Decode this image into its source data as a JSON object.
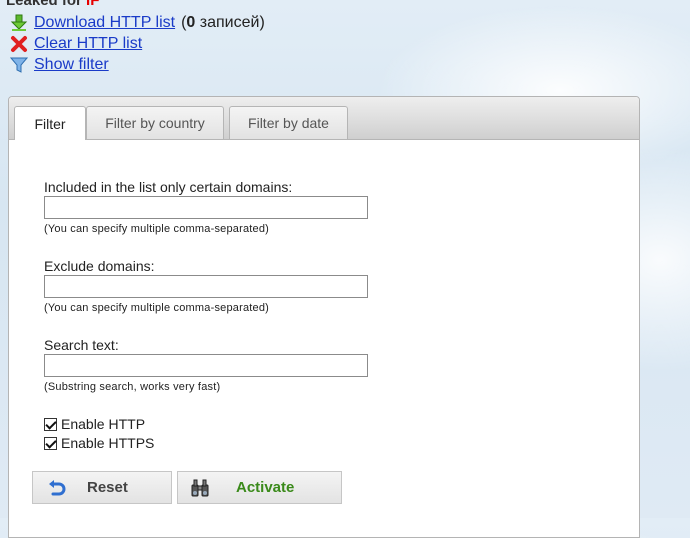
{
  "header": {
    "prefix": "Leaked for",
    "tag": "IF"
  },
  "actions": {
    "download_link": "Download HTTP list",
    "count_open": "(",
    "count_value": "0",
    "count_suffix": " записей)",
    "clear_link": "Clear HTTP list",
    "show_filter_link": "Show filter"
  },
  "tabs": [
    {
      "label": "Filter",
      "active": true
    },
    {
      "label": "Filter by country",
      "active": false
    },
    {
      "label": "Filter by date",
      "active": false
    }
  ],
  "filter": {
    "included_label": "Included in the list only certain domains:",
    "included_value": "",
    "included_hint": "(You can specify multiple comma-separated)",
    "exclude_label": "Exclude domains:",
    "exclude_value": "",
    "exclude_hint": "(You can specify multiple comma-separated)",
    "search_label": "Search text:",
    "search_value": "",
    "search_hint": "(Substring search, works very fast)",
    "enable_http_label": "Enable HTTP",
    "enable_http_checked": true,
    "enable_https_label": "Enable HTTPS",
    "enable_https_checked": true
  },
  "buttons": {
    "reset_label": "Reset",
    "activate_label": "Activate"
  },
  "icons": {
    "download": "download-arrow-icon",
    "clear": "red-x-icon",
    "filter": "funnel-icon",
    "reset": "undo-arrow-icon",
    "activate": "binoculars-icon"
  },
  "colors": {
    "link": "#1a3bc8",
    "tag": "#e60000",
    "activate_text": "#3a8a1a"
  }
}
